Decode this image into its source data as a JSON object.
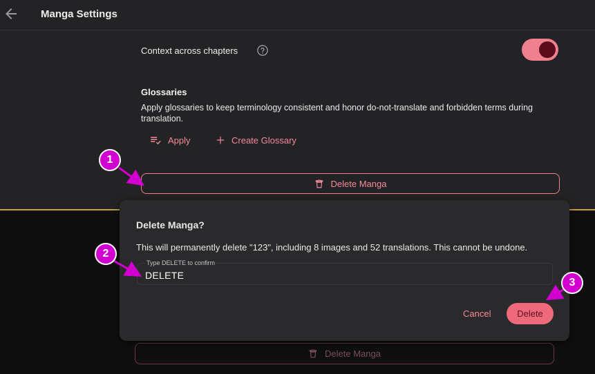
{
  "header": {
    "title": "Manga Settings",
    "back_icon": "arrow-left-icon"
  },
  "settings": {
    "context_label": "Context across chapters",
    "context_enabled": true,
    "glossaries_title": "Glossaries",
    "glossaries_desc": "Apply glossaries to keep terminology consistent and honor do-not-translate and forbidden terms during translation.",
    "apply_label": "Apply",
    "create_label": "Create Glossary",
    "delete_manga_label": "Delete Manga"
  },
  "dialog": {
    "title": "Delete Manga?",
    "message": "This will permanently delete \"123\", including 8 images and 52 translations. This cannot be undone.",
    "input_label": "Type DELETE to confirm",
    "input_value": "DELETE",
    "cancel_label": "Cancel",
    "delete_label": "Delete"
  },
  "background": {
    "delete_manga_label": "Delete Manga"
  },
  "annotations": [
    "1",
    "2",
    "3"
  ],
  "colors": {
    "accent": "#f0808e",
    "toggle_knob": "#5c0b1d",
    "badge": "#d100d1",
    "divider": "#c9a23a"
  }
}
